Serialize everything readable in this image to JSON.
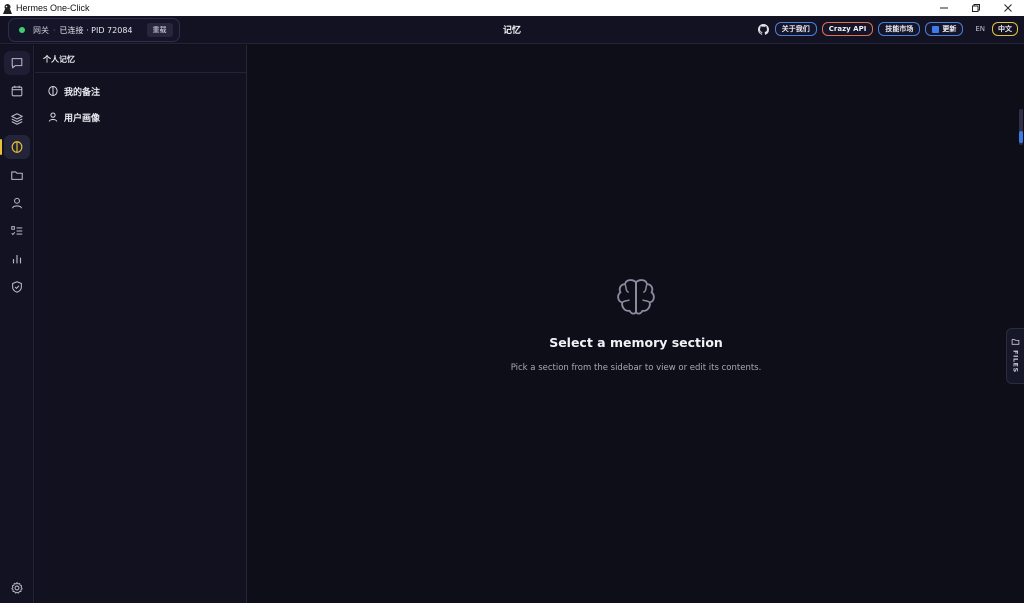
{
  "window": {
    "title": "Hermes One-Click",
    "controls": [
      "minimize-icon",
      "restore-icon",
      "close-icon"
    ]
  },
  "header": {
    "gateway": {
      "label": "网关",
      "separator": "·",
      "status": "已连接 · PID 72084",
      "status_color": "#3ecf6e",
      "reload_label": "重载"
    },
    "page_title": "记忆",
    "links": {
      "about": "关于我们",
      "crazy_api": "Crazy API",
      "skills_market": "技能市场",
      "update": "更新"
    },
    "languages": {
      "en": "EN",
      "zh": "中文",
      "active": "zh"
    }
  },
  "rail": {
    "items": [
      {
        "icon": "chat-icon"
      },
      {
        "icon": "calendar-icon"
      },
      {
        "icon": "layers-icon"
      },
      {
        "icon": "memory-icon",
        "active": true
      },
      {
        "icon": "folder-icon"
      },
      {
        "icon": "user-icon"
      },
      {
        "icon": "checklist-icon"
      },
      {
        "icon": "bar-chart-icon"
      },
      {
        "icon": "shield-icon"
      }
    ],
    "bottom_icon": "gear-icon",
    "accent": "#e8c235"
  },
  "memory_sidebar": {
    "heading": "个人记忆",
    "items": [
      {
        "label": "我的备注",
        "icon": "memory-icon"
      },
      {
        "label": "用户画像",
        "icon": "user-icon"
      }
    ]
  },
  "main": {
    "empty_icon": "brain-icon",
    "empty_title": "Select a memory section",
    "empty_subtitle": "Pick a section from the sidebar to view or edit its contents.",
    "files_tab_label": "FILES"
  }
}
